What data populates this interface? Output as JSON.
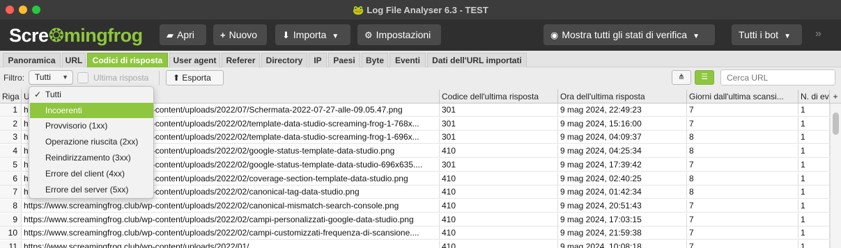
{
  "window": {
    "title": "Log File Analyser 6.3 - TEST"
  },
  "logo": {
    "part1": "Scre",
    "part2": "mingfrog",
    "icon": "frog-icon"
  },
  "toolbar": {
    "open": "Apri",
    "new": "Nuovo",
    "import": "Importa",
    "settings": "Impostazioni",
    "status_filter": "Mostra tutti gli stati di verifica",
    "bots": "Tutti i bot",
    "more": "»"
  },
  "tabs": [
    "Panoramica",
    "URL",
    "Codici di risposta",
    "User agent",
    "Referer",
    "Directory",
    "IP",
    "Paesi",
    "Byte",
    "Eventi",
    "Dati dell'URL importati"
  ],
  "active_tab": "Codici di risposta",
  "filter": {
    "label": "Filtro:",
    "selected": "Tutti",
    "last_response_label": "Ultima risposta",
    "export": "Esporta",
    "search_placeholder": "Cerca URL"
  },
  "dropdown": {
    "items": [
      "Tutti",
      "Incoerenti",
      "Provvisorio (1xx)",
      "Operazione riuscita (2xx)",
      "Reindirizzamento (3xx)",
      "Errore del client (4xx)",
      "Errore del server (5xx)"
    ],
    "checked": "Tutti",
    "highlighted": "Incoerenti"
  },
  "table": {
    "columns": [
      "Riga",
      "URL",
      "Codice dell'ultima risposta",
      "Ora dell'ultima risposta",
      "Giorni dall'ultima scansi...",
      "N. di ev"
    ],
    "add_column": "+",
    "rows": [
      [
        "1",
        "https://www.screamingfrog.club/wp-content/uploads/2022/07/Schermata-2022-07-27-alle-09.05.47.png",
        "301",
        "9 mag 2024, 22:49:23",
        "7",
        "1"
      ],
      [
        "2",
        "https://www.screamingfrog.club/wp-content/uploads/2022/02/template-data-studio-screaming-frog-1-768x...",
        "301",
        "9 mag 2024, 15:16:00",
        "7",
        "1"
      ],
      [
        "3",
        "https://www.screamingfrog.club/wp-content/uploads/2022/02/template-data-studio-screaming-frog-1-696x...",
        "301",
        "9 mag 2024, 04:09:37",
        "8",
        "1"
      ],
      [
        "4",
        "https://www.screamingfrog.club/wp-content/uploads/2022/02/google-status-template-data-studio.png",
        "410",
        "9 mag 2024, 04:25:34",
        "8",
        "1"
      ],
      [
        "5",
        "https://www.screamingfrog.club/wp-content/uploads/2022/02/google-status-template-data-studio-696x635....",
        "301",
        "9 mag 2024, 17:39:42",
        "7",
        "1"
      ],
      [
        "6",
        "https://www.screamingfrog.club/wp-content/uploads/2022/02/coverage-section-template-data-studio.png",
        "410",
        "9 mag 2024, 02:40:25",
        "8",
        "1"
      ],
      [
        "7",
        "https://www.screamingfrog.club/wp-content/uploads/2022/02/canonical-tag-data-studio.png",
        "410",
        "9 mag 2024, 01:42:34",
        "8",
        "1"
      ],
      [
        "8",
        "https://www.screamingfrog.club/wp-content/uploads/2022/02/canonical-mismatch-search-console.png",
        "410",
        "9 mag 2024, 20:51:43",
        "7",
        "1"
      ],
      [
        "9",
        "https://www.screamingfrog.club/wp-content/uploads/2022/02/campi-personalizzati-google-data-studio.png",
        "410",
        "9 mag 2024, 17:03:15",
        "7",
        "1"
      ],
      [
        "10",
        "https://www.screamingfrog.club/wp-content/uploads/2022/02/campi-customizzati-frequenza-di-scansione....",
        "410",
        "9 mag 2024, 21:59:38",
        "7",
        "1"
      ],
      [
        "11",
        "https://www.screamingfrog.club/wp-content/uploads/2022/01/...",
        "410",
        "9 mag 2024, 10:08:18",
        "7",
        "1"
      ]
    ]
  },
  "colors": {
    "accent": "#8ec63f",
    "toolbar_bg": "#2f2f2f",
    "titlebar_bg": "#3c3c3c"
  }
}
